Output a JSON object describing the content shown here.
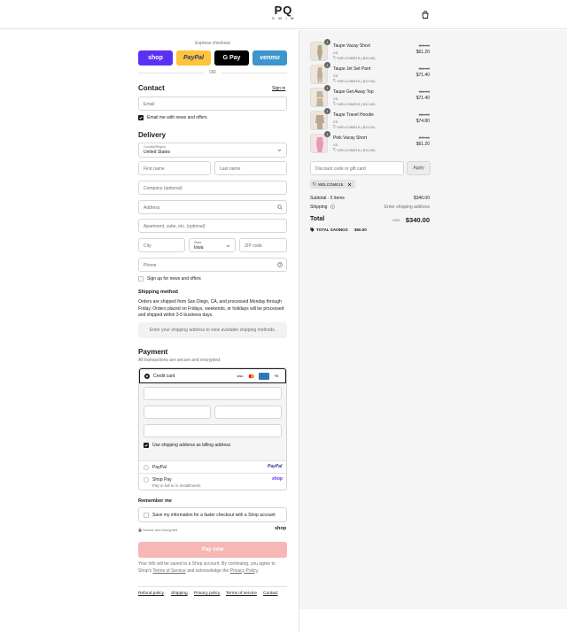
{
  "header": {
    "logo_main": "PQ",
    "logo_sub": "SWIM",
    "cart_icon": "shopping-bag-icon"
  },
  "express": {
    "label": "Express checkout",
    "buttons": [
      {
        "label": "shop",
        "bg": "#5a31f4",
        "fg": "#ffffff"
      },
      {
        "label": "PayPal",
        "bg": "#ffc439",
        "fg": "#253b80"
      },
      {
        "label": "G Pay",
        "bg": "#000000",
        "fg": "#ffffff"
      },
      {
        "label": "venmo",
        "bg": "#3d95ce",
        "fg": "#ffffff"
      }
    ],
    "or": "OR"
  },
  "contact": {
    "title": "Contact",
    "signin": "Sign in",
    "email_placeholder": "Email",
    "news_label": "Email me with news and offers"
  },
  "delivery": {
    "title": "Delivery",
    "country_label": "Country/Region",
    "country_value": "United States",
    "first_name": "First name",
    "last_name": "Last name",
    "company": "Company (optional)",
    "address": "Address",
    "apartment": "Apartment, suite, etc. (optional)",
    "city": "City",
    "state_label": "State",
    "state_value": "Iowa",
    "zip": "ZIP code",
    "phone": "Phone",
    "sms_label": "Sign up for news and offers"
  },
  "shipping_method": {
    "title": "Shipping method",
    "text": "Orders are shipped from San Diego, CA, and processed Monday through Friday. Orders placed on Fridays, weekends, or holidays will be processed and shipped within 3-5 business days.",
    "notice": "Enter your shipping address to view available shipping methods."
  },
  "payment": {
    "title": "Payment",
    "subtitle": "All transactions are secure and encrypted.",
    "credit_card": "Credit card",
    "card_badges": [
      "VISA",
      "MC",
      "AMEX"
    ],
    "more_cards": "+5",
    "billing_label": "Use shipping address as billing address",
    "paypal": "PayPal",
    "paypal_logo": "PayPal",
    "shop_pay": "Shop Pay",
    "shop_pay_sub": "Pay in full or in installments",
    "shop_logo": "shop"
  },
  "remember": {
    "title": "Remember me",
    "label": "Save my information for a faster checkout with a Shop account",
    "secure": "Secure and encrypted",
    "shop_logo": "shop"
  },
  "pay_now": "Pay now",
  "disclaimer_prefix": "Your info will be saved to a Shop account. By continuing, you agree to Shop's",
  "disclaimer_terms": "Terms of Service",
  "disclaimer_mid": "and acknowledge the",
  "disclaimer_privacy": "Privacy Policy",
  "disclaimer_end": ".",
  "footer_links": [
    "Refund policy",
    "Shipping",
    "Privacy policy",
    "Terms of service",
    "Contact"
  ],
  "summary": {
    "items": [
      {
        "qty": "1",
        "name": "Taupe Vacay Short",
        "size": "XS",
        "discount": "WELCOME15 (-$10.80)",
        "original": "$72.00",
        "price": "$61.20"
      },
      {
        "qty": "1",
        "name": "Taupe Jet Set Pant",
        "size": "XS",
        "discount": "WELCOME15 (-$12.60)",
        "original": "$84.00",
        "price": "$71.40"
      },
      {
        "qty": "1",
        "name": "Taupe Get Away Top",
        "size": "XS",
        "discount": "WELCOME15 (-$12.60)",
        "original": "$84.00",
        "price": "$71.40"
      },
      {
        "qty": "1",
        "name": "Taupe Travel Hoodie",
        "size": "XS",
        "discount": "WELCOME15 (-$13.20)",
        "original": "$88.00",
        "price": "$74.80"
      },
      {
        "qty": "1",
        "name": "Pink Vacay Short",
        "size": "XS",
        "discount": "WELCOME15 (-$10.80)",
        "original": "$72.00",
        "price": "$61.20"
      }
    ],
    "discount_placeholder": "Discount code or gift card",
    "apply": "Apply",
    "applied_code": "WELCOME15",
    "subtotal_label": "Subtotal · 5 items",
    "subtotal_value": "$340.00",
    "shipping_label": "Shipping",
    "shipping_value": "Enter shipping address",
    "total_label": "Total",
    "currency": "USD",
    "total_value": "$340.00",
    "savings_label": "TOTAL SAVINGS",
    "savings_value": "$60.00"
  }
}
